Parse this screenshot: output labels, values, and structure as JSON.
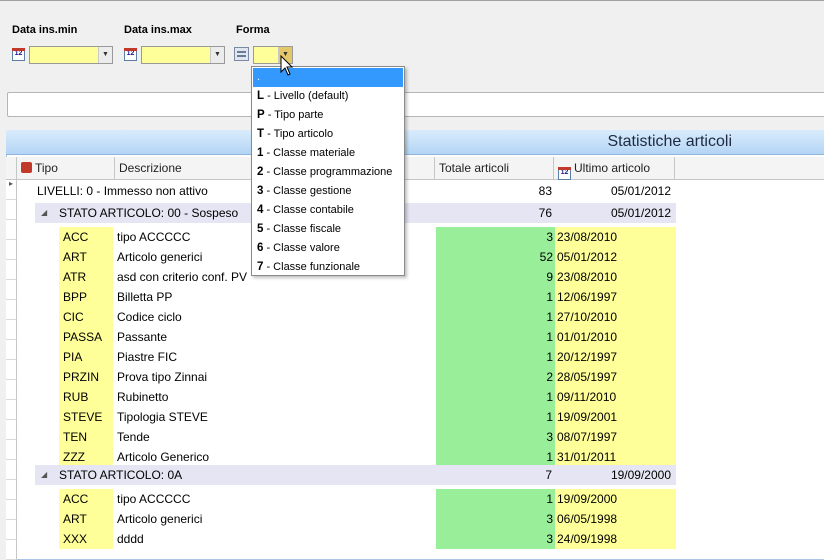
{
  "filters": {
    "data_ins_min_label": "Data ins.min",
    "data_ins_max_label": "Data ins.max",
    "forma_label": "Forma",
    "calendar_icon_text": "12",
    "data_ins_min_value": "",
    "data_ins_max_value": "",
    "forma_value": ""
  },
  "search": {
    "value": ""
  },
  "panel": {
    "title": "Statistiche articoli"
  },
  "columns": {
    "tipo": "Tipo",
    "descrizione": "Descrizione",
    "totale": "Totale articoli",
    "ultimo": "Ultimo articolo"
  },
  "dropdown": {
    "items": [
      {
        "key": "",
        "label": "."
      },
      {
        "key": "L",
        "label": " - Livello (default)"
      },
      {
        "key": "P",
        "label": " - Tipo parte"
      },
      {
        "key": "T",
        "label": " - Tipo articolo"
      },
      {
        "key": "1",
        "label": " - Classe materiale"
      },
      {
        "key": "2",
        "label": " - Classe programmazione"
      },
      {
        "key": "3",
        "label": " - Classe gestione"
      },
      {
        "key": "4",
        "label": " - Classe contabile"
      },
      {
        "key": "5",
        "label": " - Classe fiscale"
      },
      {
        "key": "6",
        "label": " - Classe valore"
      },
      {
        "key": "7",
        "label": " - Classe funzionale"
      }
    ]
  },
  "grid": {
    "level_row": {
      "label": "LIVELLI: 0 - Immesso non attivo",
      "total": "83",
      "last": "05/01/2012"
    },
    "group1": {
      "label": "STATO ARTICOLO: 00 - Sospeso",
      "total": "76",
      "last": "05/01/2012",
      "rows": [
        {
          "tipo": "ACC",
          "desc": "tipo ACCCCC",
          "total": "3",
          "last": "23/08/2010"
        },
        {
          "tipo": "ART",
          "desc": "Articolo generici",
          "total": "52",
          "last": "05/01/2012"
        },
        {
          "tipo": "ATR",
          "desc": "asd con criterio conf. PV",
          "total": "9",
          "last": "23/08/2010"
        },
        {
          "tipo": "BPP",
          "desc": "Billetta PP",
          "total": "1",
          "last": "12/06/1997"
        },
        {
          "tipo": "CIC",
          "desc": "Codice ciclo",
          "total": "1",
          "last": "27/10/2010"
        },
        {
          "tipo": "PASSA",
          "desc": "Passante",
          "total": "1",
          "last": "01/01/2010"
        },
        {
          "tipo": "PIA",
          "desc": "Piastre FIC",
          "total": "1",
          "last": "20/12/1997"
        },
        {
          "tipo": "PRZIN",
          "desc": "Prova tipo Zinnai",
          "total": "2",
          "last": "28/05/1997"
        },
        {
          "tipo": "RUB",
          "desc": "Rubinetto",
          "total": "1",
          "last": "09/11/2010"
        },
        {
          "tipo": "STEVE",
          "desc": "Tipologia STEVE",
          "total": "1",
          "last": "19/09/2001"
        },
        {
          "tipo": "TEN",
          "desc": "Tende",
          "total": "3",
          "last": "08/07/1997"
        },
        {
          "tipo": "ZZZ",
          "desc": "Articolo Generico",
          "total": "1",
          "last": "31/01/2011"
        }
      ]
    },
    "group2": {
      "label": "STATO ARTICOLO: 0A",
      "total": "7",
      "last": "19/09/2000",
      "rows": [
        {
          "tipo": "ACC",
          "desc": "tipo ACCCCC",
          "total": "1",
          "last": "19/09/2000"
        },
        {
          "tipo": "ART",
          "desc": "Articolo generici",
          "total": "3",
          "last": "06/05/1998"
        },
        {
          "tipo": "XXX",
          "desc": "dddd",
          "total": "3",
          "last": "24/09/1998"
        }
      ]
    }
  },
  "colors": {
    "highlight_yellow": "#ffff99",
    "highlight_green": "#99ee99",
    "selection_blue": "#3399ff",
    "group_band": "#e5e5f3"
  }
}
